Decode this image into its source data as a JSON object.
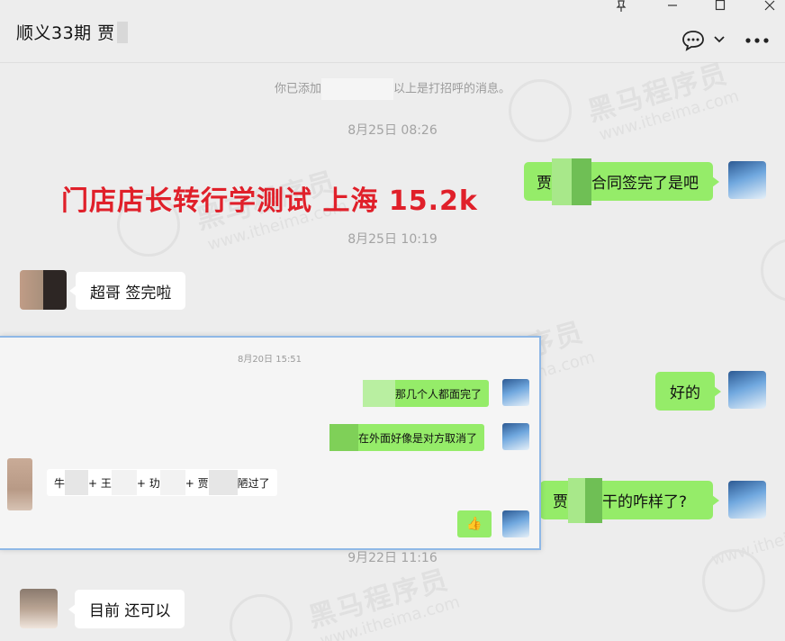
{
  "header": {
    "title": "顺义33期 贾",
    "pin_icon": "pin-icon",
    "minimize_icon": "minimize-icon",
    "maximize_icon": "maximize-icon",
    "close_icon": "close-icon",
    "chat_icon": "chat-bubble-icon",
    "dropdown_icon": "chevron-down-icon",
    "more_icon": "more-icon"
  },
  "watermark": {
    "cn": "黑马程序员",
    "en": "www.itheima.com"
  },
  "overlay": {
    "headline": "门店店长转行学测试  上海 15.2k"
  },
  "chat": {
    "system_left": "你已添加",
    "system_right": "以上是打招呼的消息。",
    "ts1": "8月25日 08:26",
    "msg1_left": "贾",
    "msg1_right": "合同签完了是吧",
    "ts2": "8月25日 10:19",
    "msg2": "超哥  签完啦",
    "msg3": "好的",
    "msg4_left": "贾",
    "msg4_right": "干的咋样了?",
    "ts3": "9月22日 11:16",
    "msg5": "目前 还可以"
  },
  "inset": {
    "ts": "8月20日 15:51",
    "m1": "那几个人都面完了",
    "m2": "在外面好像是对方取消了",
    "m3_a": "牛",
    "m3_b": "+ 王",
    "m3_c": "+ 玏",
    "m3_d": "+ 贾",
    "m3_e": "陋过了",
    "thumb_icon": "thumbs-up-icon"
  }
}
